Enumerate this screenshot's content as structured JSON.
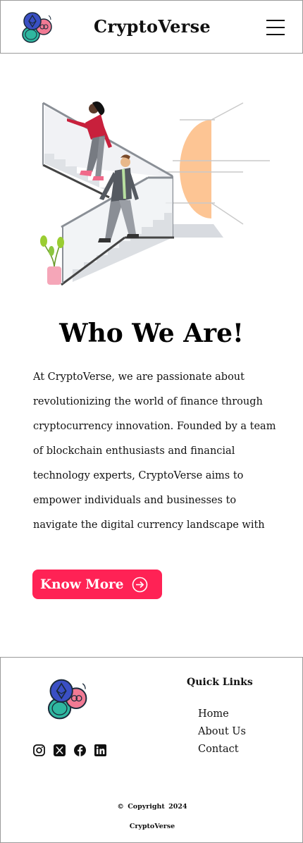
{
  "header": {
    "brand": "CryptoVerse",
    "logo_icon": "crypto-coins-logo-icon",
    "menu_icon": "hamburger-menu-icon"
  },
  "about": {
    "illustration": "people-climbing-stairs-illustration",
    "title": "Who We Are!",
    "lines": [
      "At CryptoVerse, we are passionate about",
      "revolutionizing the world of finance through",
      "cryptocurrency innovation. Founded by a team",
      "of blockchain enthusiasts and financial",
      "technology experts, CryptoVerse aims to",
      "empower individuals and businesses to",
      "navigate the digital currency landscape with"
    ],
    "cta_label": "Know More",
    "cta_icon": "arrow-right-circle-icon"
  },
  "footer": {
    "logo_icon": "crypto-coins-logo-icon",
    "social_icons": [
      "instagram-icon",
      "x-twitter-icon",
      "facebook-icon",
      "linkedin-icon"
    ],
    "quick_links_title": "Quick Links",
    "links": [
      "Home",
      "About Us",
      "Contact"
    ],
    "copyright": "© Copyright 2024",
    "brand": "CryptoVerse"
  },
  "colors": {
    "accent": "#ff2255",
    "border": "#9a9a9a",
    "illustration_orange": "#fdbf88",
    "logo_blue": "#3a4fc4",
    "logo_pink": "#f17a94",
    "logo_teal": "#2fb7a0"
  }
}
